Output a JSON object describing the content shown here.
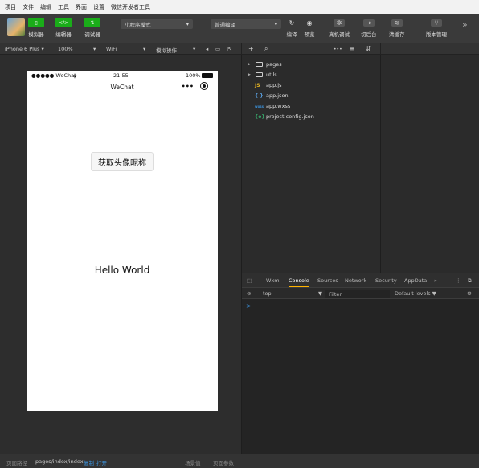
{
  "menubar": {
    "items": [
      "项目",
      "文件",
      "编辑",
      "工具",
      "界面",
      "设置",
      "微信开发者工具"
    ]
  },
  "toolbar": {
    "simulator_label": "模拟器",
    "editor_label": "编辑器",
    "debugger_label": "调试器",
    "mode_select": "小程序模式",
    "compile_select": "普通编译",
    "compile_label": "编译",
    "preview_label": "预览",
    "remote_debug_label": "真机调试",
    "background_label": "切后台",
    "clear_cache_label": "清缓存",
    "version_label": "版本管理",
    "more_label": "»"
  },
  "simbar": {
    "device": "iPhone 6 Plus",
    "zoom": "100%",
    "network": "WiFi",
    "operation": "模拟操作"
  },
  "phone": {
    "carrier": "●●●●● WeChat",
    "time": "21:55",
    "battery": "100%",
    "nav_title": "WeChat",
    "capsule_dots": "•••",
    "get_profile_button": "获取头像昵称",
    "hello_text": "Hello World"
  },
  "filetree": {
    "items": [
      {
        "type": "folder",
        "name": "pages"
      },
      {
        "type": "folder",
        "name": "utils"
      },
      {
        "type": "js",
        "icon": "JS",
        "name": "app.js"
      },
      {
        "type": "json",
        "icon": "{ }",
        "name": "app.json"
      },
      {
        "type": "wxss",
        "icon": "wxss",
        "name": "app.wxss"
      },
      {
        "type": "cfg",
        "icon": "{o}",
        "name": "project.config.json"
      }
    ]
  },
  "devtools": {
    "tabs": [
      "Wxml",
      "Console",
      "Sources",
      "Network",
      "Security",
      "AppData",
      "»"
    ],
    "active_tab": "Console",
    "context": "top",
    "filter_placeholder": "Filter",
    "levels": "Default levels ▼",
    "prompt": ">"
  },
  "statusbar": {
    "path_label": "页面路径",
    "path_value": "pages/index/index",
    "copy_label": "复制",
    "open_label": "打开",
    "scene_label": "场景值",
    "params_label": "页面参数"
  },
  "colors": {
    "accent_green": "#1aad19",
    "active_tab_underline": "#ffb300",
    "link_blue": "#3b8fd6"
  }
}
